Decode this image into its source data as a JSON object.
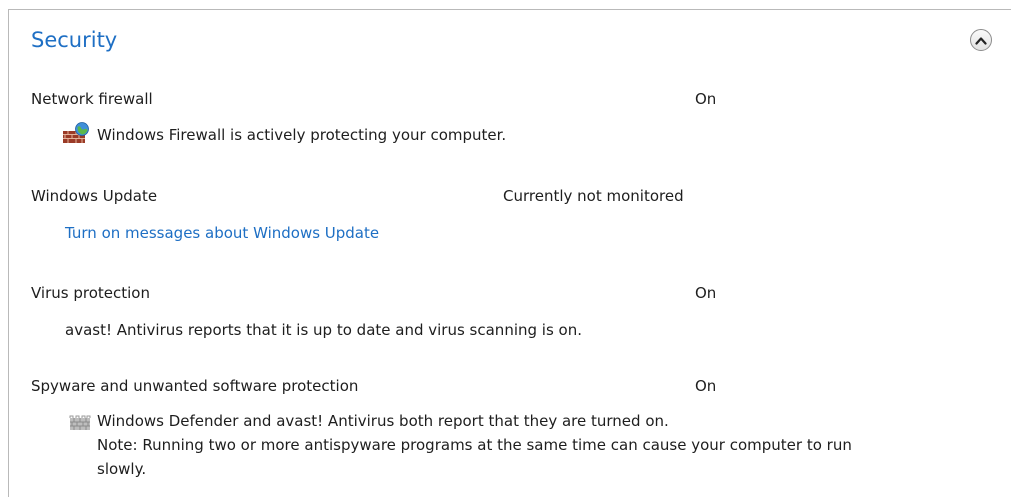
{
  "section": {
    "title": "Security",
    "collapse_icon": "chevron-up-circle-icon"
  },
  "items": [
    {
      "label": "Network firewall",
      "status": "On",
      "icon": "firewall-globe-icon",
      "detail": "Windows Firewall is actively protecting your computer."
    },
    {
      "label": "Windows Update",
      "status": "Currently not monitored",
      "link": "Turn on messages about Windows Update"
    },
    {
      "label": "Virus protection",
      "status": "On",
      "detail": "avast! Antivirus reports that it is up to date and virus scanning is on."
    },
    {
      "label": "Spyware and unwanted software protection",
      "status": "On",
      "icon": "defender-wall-icon",
      "detail_lines": [
        "Windows Defender and avast! Antivirus both report that they are turned on.",
        "Note: Running two or more antispyware programs at the same time can cause your computer to run",
        "slowly."
      ]
    }
  ]
}
